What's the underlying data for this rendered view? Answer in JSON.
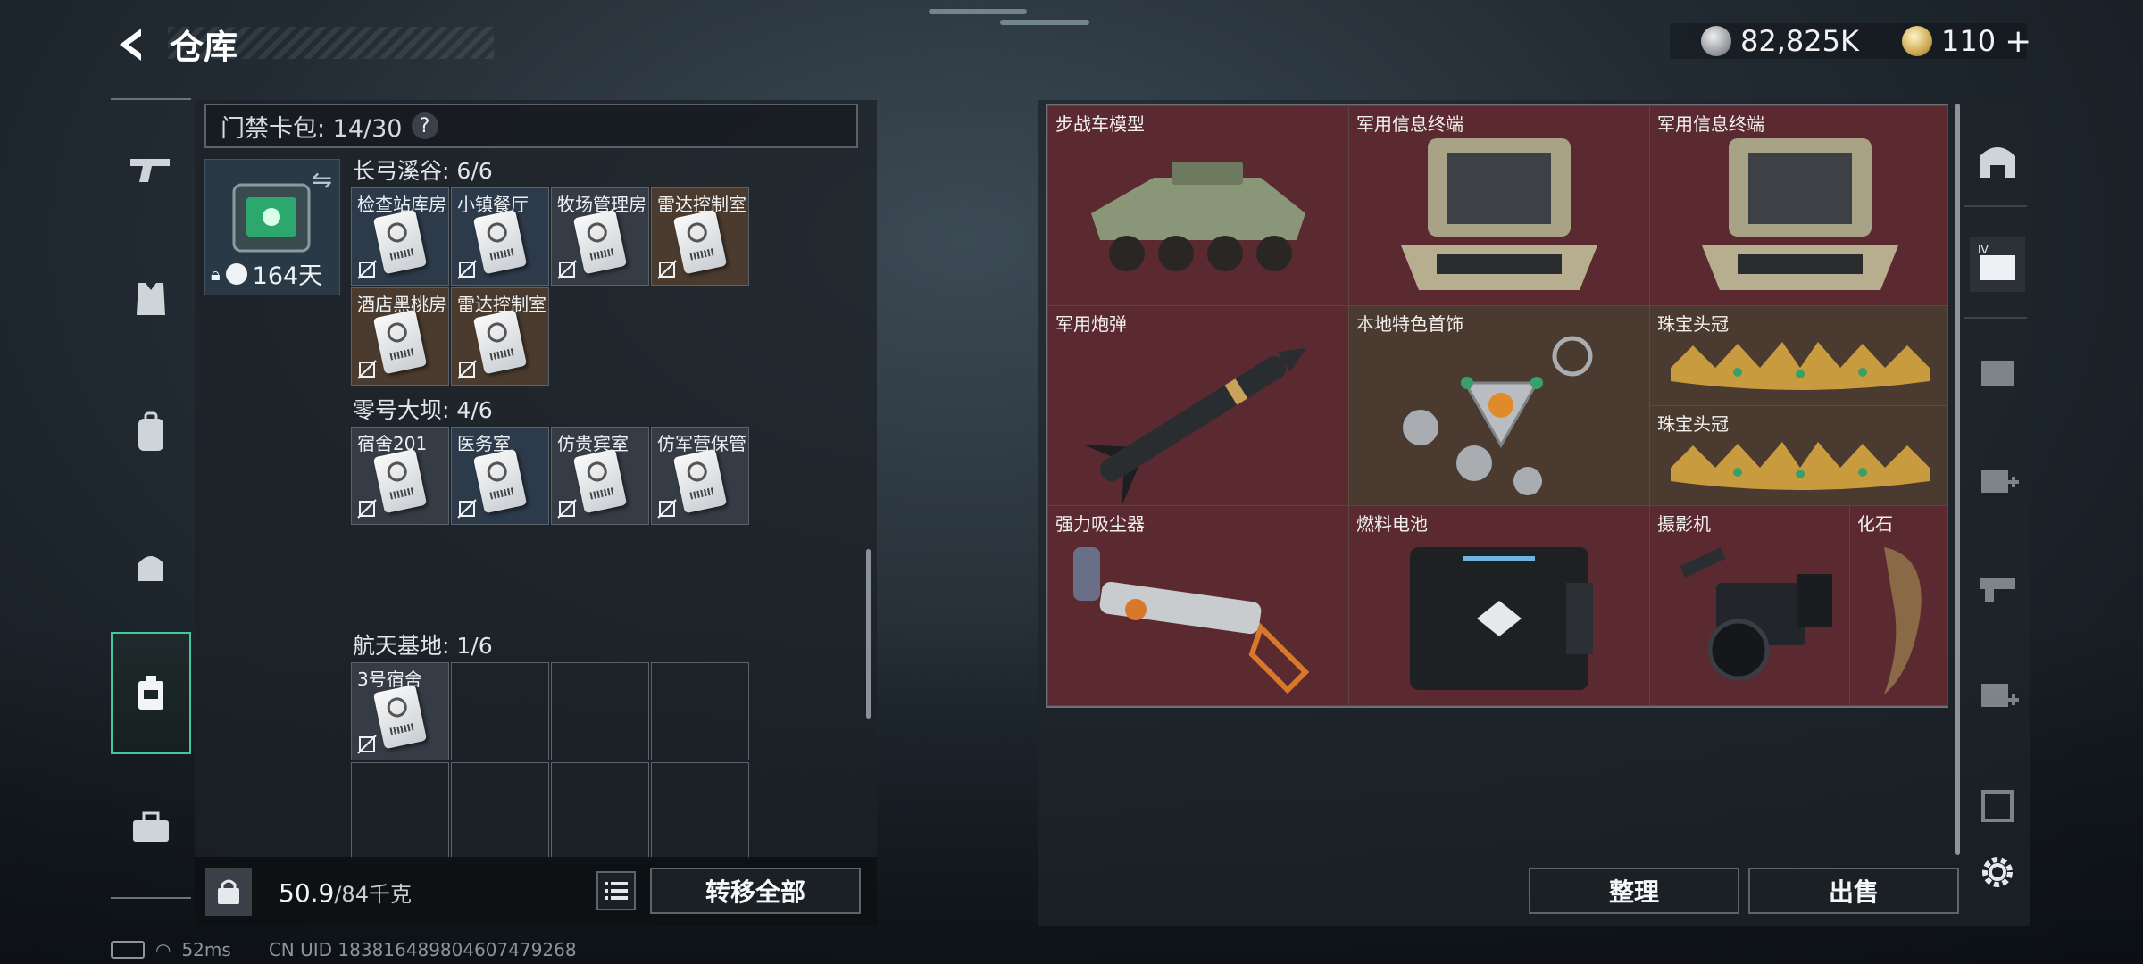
{
  "header": {
    "title": "仓库",
    "silver_amount": "82,825K",
    "gold_amount": "110",
    "gold_plus": "+"
  },
  "keybag": {
    "label": "门禁卡包: 14/30",
    "help": "?",
    "days_left": "164天",
    "regions": [
      {
        "title": "长弓溪谷: 6/6",
        "cards": [
          {
            "name": "检查站库房",
            "tint": "blue"
          },
          {
            "name": "小镇餐厅",
            "tint": "blue"
          },
          {
            "name": "牧场管理房",
            "tint": "grey"
          },
          {
            "name": "雷达控制室",
            "tint": "brown"
          },
          {
            "name": "酒店黑桃房",
            "tint": "brown"
          },
          {
            "name": "雷达控制室",
            "tint": "brown"
          }
        ]
      },
      {
        "title": "零号大坝: 4/6",
        "cards": [
          {
            "name": "宿舍201",
            "tint": "grey"
          },
          {
            "name": "医务室",
            "tint": "blue"
          },
          {
            "name": "仿贵宾室",
            "tint": "grey"
          },
          {
            "name": "仿军营保管",
            "tint": "grey"
          }
        ]
      },
      {
        "title": "航天基地: 1/6",
        "cards": [
          {
            "name": "3号宿舍",
            "tint": "grey"
          }
        ]
      }
    ]
  },
  "bottom_left": {
    "weight_value": "50.9",
    "weight_capacity": "/84千克",
    "transfer_all": "转移全部"
  },
  "storage": {
    "items": [
      {
        "name": "步战车模型",
        "tint": "red"
      },
      {
        "name": "军用信息终端",
        "tint": "red"
      },
      {
        "name": "军用信息终端",
        "tint": "red"
      },
      {
        "name": "军用炮弹",
        "tint": "red"
      },
      {
        "name": "本地特色首饰",
        "tint": "brown"
      },
      {
        "name": "珠宝头冠",
        "tint": "brown"
      },
      {
        "name": "珠宝头冠",
        "tint": "brown"
      },
      {
        "name": "强力吸尘器",
        "tint": "red"
      },
      {
        "name": "燃料电池",
        "tint": "red"
      },
      {
        "name": "摄影机",
        "tint": "red"
      },
      {
        "name": "化石",
        "tint": "red"
      }
    ],
    "sort_button": "整理",
    "sell_button": "出售"
  },
  "categories": [
    "safe-box-icon",
    "tier-iv-gear-icon",
    "gear-icon-1",
    "tier-ii-medkit-icon",
    "tier-iii-gun-icon",
    "tier-ii-medkit-icon-2",
    "tier-iii-armor-icon"
  ],
  "status": {
    "ping": "52ms",
    "uid": "CN UID 183816489804607479268"
  },
  "colors": {
    "accent_green": "#44c79a",
    "cell_red": "#5a2a30",
    "cell_brown": "#4b3a30"
  }
}
